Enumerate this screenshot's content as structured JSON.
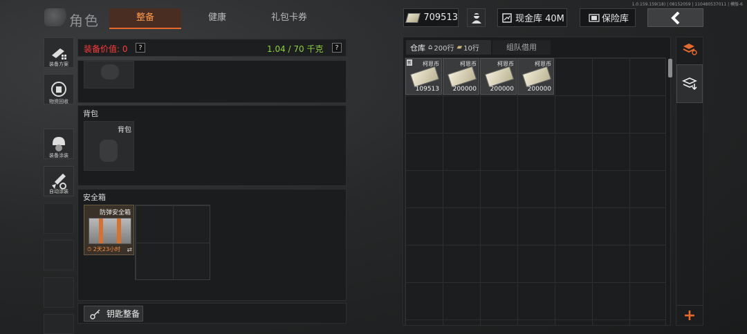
{
  "version": "1.0.159.159(18) | 08152059 | 110480537011 | 模版-6",
  "header": {
    "title": "角色",
    "tabs": [
      {
        "label": "整备",
        "active": true
      },
      {
        "label": "健康",
        "active": false
      },
      {
        "label": "礼包卡券",
        "active": false
      }
    ],
    "currency_value": "709513",
    "cash_vault_label": "现金库 40M",
    "safe_vault_label": "保险库"
  },
  "sidebar": {
    "items": [
      {
        "label": "装备方案",
        "icon": "loadout-icon"
      },
      {
        "label": "物资回收",
        "icon": "recycle-icon"
      },
      {
        "label": "装备涂装",
        "icon": "helmet-skin-icon"
      },
      {
        "label": "自动涂装",
        "icon": "auto-paint-icon"
      }
    ]
  },
  "equipment": {
    "value_label": "装备价值: 0",
    "weight_label": "1.04 / 70 千克",
    "help": "?",
    "backpack_section": "背包",
    "backpack_slot_label": "背包",
    "safebox_section": "安全箱",
    "safebox_name": "防弹安全箱",
    "safebox_timer": "2天23小时",
    "key_button": "钥匙整备"
  },
  "warehouse": {
    "tab_label": "仓库",
    "rows_label": "200行",
    "cash_rows_label": "10行",
    "team_loan_label": "组队借用",
    "new_badge": "新",
    "items": [
      {
        "name": "柯恩币",
        "count": "109513",
        "new": true
      },
      {
        "name": "柯恩币",
        "count": "200000",
        "new": false
      },
      {
        "name": "柯恩币",
        "count": "200000",
        "new": false
      },
      {
        "name": "柯恩币",
        "count": "200000",
        "new": false
      }
    ]
  },
  "colors": {
    "accent_orange": "#e8692c",
    "value_red": "#ff3b3b",
    "weight_green": "#8cd43c"
  }
}
